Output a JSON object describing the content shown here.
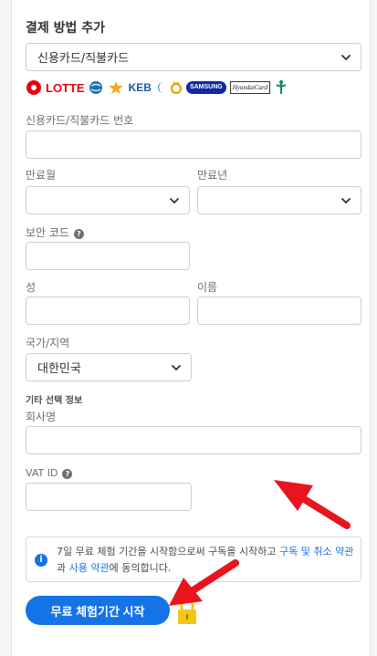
{
  "section_title": "결제 방법 추가",
  "payment_type": {
    "selected": "신용카드/직불카드"
  },
  "card_brands": [
    "LOTTE",
    "KEB",
    "SAMSUNG",
    "HyundaiCard"
  ],
  "fields": {
    "card_number_label": "신용카드/직불카드 번호",
    "expiry_month_label": "만료월",
    "expiry_year_label": "만료년",
    "security_code_label": "보안 코드",
    "last_name_label": "성",
    "first_name_label": "이름",
    "country_label": "국가/지역",
    "country_value": "대한민국",
    "optional_info_label": "기타 선택 정보",
    "company_label": "회사명",
    "vat_label": "VAT ID"
  },
  "help_icon_glyph": "?",
  "info_icon_glyph": "i",
  "notice": {
    "text_1": "7일 무료 체험 기간을 시작함으로써 구독을 시작하고 ",
    "link_1": "구독 및 취소 약관",
    "text_2": "과 ",
    "link_2": "사용 약관",
    "text_3": "에 동의합니다."
  },
  "cta_label": "무료 체험기간 시작",
  "colors": {
    "accent": "#1473e6",
    "arrow": "#e8141e",
    "lock": "#f6c417"
  }
}
